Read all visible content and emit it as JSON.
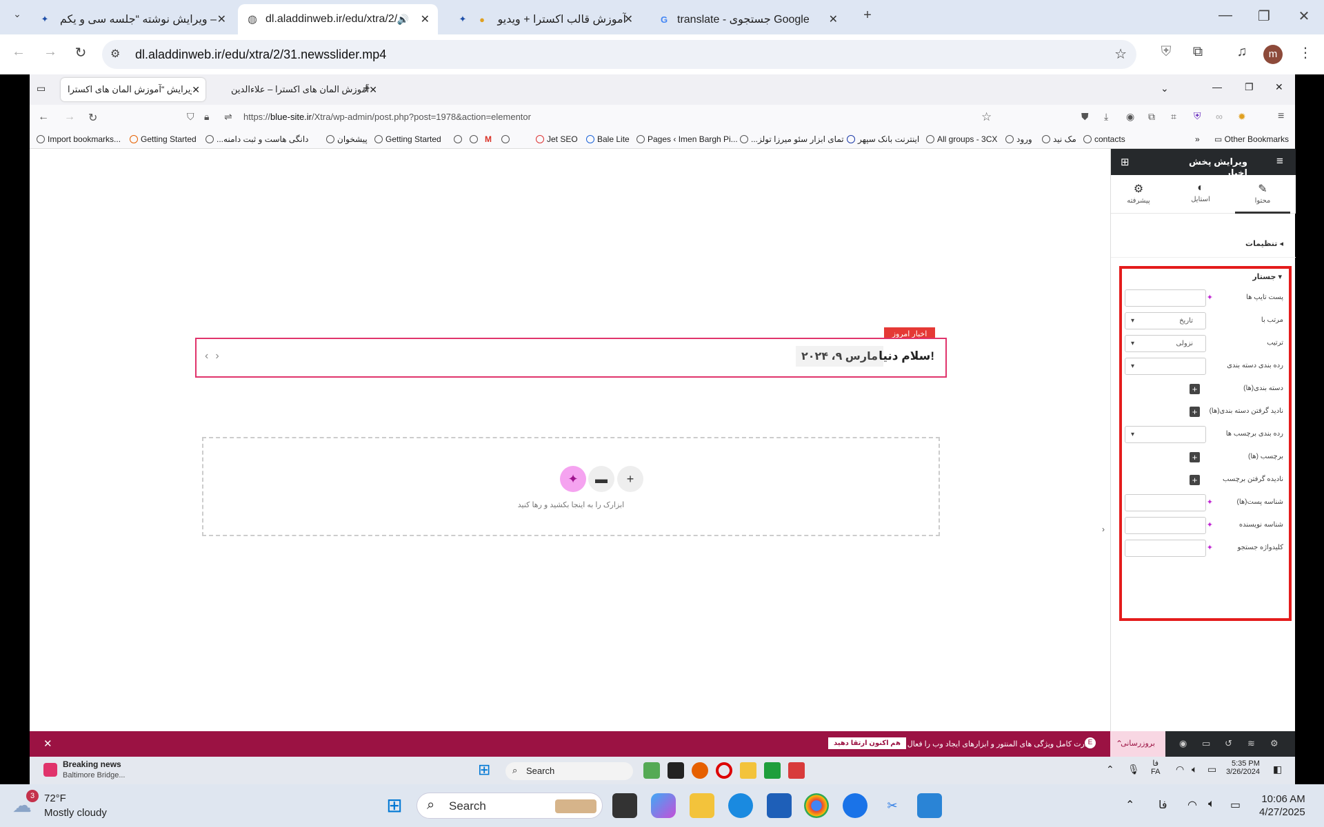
{
  "outer_tabs": [
    {
      "label": "ویرایش نوشته “جلسه سی و یکم –",
      "active": false
    },
    {
      "label": "dl.aladdinweb.ir/edu/xtra/2/",
      "active": true
    },
    {
      "label": "آموزش قالب اکسترا + ویدیو",
      "active": false
    },
    {
      "label": "translate - جستجوی Google",
      "active": false
    }
  ],
  "outer_url": "dl.aladdinweb.ir/edu/xtra/2/31.newsslider.mp4",
  "inner_tabs": [
    {
      "label": "ویرایش “آموزش المان های اکسترا – ",
      "active": true
    },
    {
      "label": "آموزش المان های اکسترا – علاءالدین",
      "active": false
    }
  ],
  "inner_url_prefix": "https://",
  "inner_url_host": "blue-site.ir",
  "inner_url_path": "/Xtra/wp-admin/post.php?post=1978&action=elementor",
  "bookmarks": [
    "Import bookmarks...",
    "Getting Started",
    "...دانگی هاست و ثبت دامنه",
    "پیشخوان",
    "Getting Started",
    "Jet SEO",
    "Bale Lite",
    "Pages ‹ Imen Bargh Pi...",
    "...تمای ابزار سئو میرزا تولز",
    "اینترنت بانک سپهر",
    "All groups - 3CX",
    "ورود",
    "مک نید",
    "contacts"
  ],
  "other_bookmarks": "Other Bookmarks",
  "news": {
    "badge": "اخبار امروز",
    "title": "سلام دنیا!",
    "date": "مارس ۹، ۲۰۲۴"
  },
  "dropzone_text": "ابزارک را به اینجا بکشید و رها کنید",
  "panel": {
    "title": "ویرایش پخش اخبار",
    "tabs": [
      {
        "label": "محتوا",
        "icon": "pencil-icon"
      },
      {
        "label": "استایل",
        "icon": "contrast-icon"
      },
      {
        "label": "پیشرفته",
        "icon": "gear-icon"
      }
    ],
    "settings_label": "تنظیمات",
    "query_label": "جستار",
    "query_rows": [
      {
        "label": "پست تایپ ها",
        "type": "input",
        "value": "",
        "dynamic": true
      },
      {
        "label": "مرتب با",
        "type": "select",
        "value": "تاریخ",
        "dynamic": false
      },
      {
        "label": "ترتیب",
        "type": "select",
        "value": "نزولی",
        "dynamic": false
      },
      {
        "label": "رده بندی دسته بندی",
        "type": "select",
        "value": "",
        "dynamic": false
      },
      {
        "label": "دسته بندی(ها)",
        "type": "plus",
        "value": "",
        "dynamic": false
      },
      {
        "label": "نادید گرفتن دسته بندی(ها)",
        "type": "plus",
        "value": "",
        "dynamic": false
      },
      {
        "label": "رده بندی برچسب ها",
        "type": "select",
        "value": "",
        "dynamic": false
      },
      {
        "label": "برچسب (ها)",
        "type": "plus",
        "value": "",
        "dynamic": false
      },
      {
        "label": "نادیده گرفتن برچسب",
        "type": "plus",
        "value": "",
        "dynamic": false
      },
      {
        "label": "شناسه پست(ها)",
        "type": "input",
        "value": "",
        "dynamic": true
      },
      {
        "label": "شناسه نویسنده",
        "type": "input",
        "value": "",
        "dynamic": true
      },
      {
        "label": "کلیدواژه جستجو",
        "type": "input",
        "value": "",
        "dynamic": true
      }
    ]
  },
  "notice": {
    "text": "قدرت کامل ویژگی های المنتور و ابزارهای ایجاد وب را فعال کنید.",
    "button": "هم اکنون ارتقا دهید"
  },
  "footer": {
    "publish": "بروزرسانی"
  },
  "inner_taskbar": {
    "news_title": "Breaking news",
    "news_sub": "Baltimore Bridge...",
    "search": "Search",
    "lang": "فا",
    "lang2": "FA",
    "time": "5:35 PM",
    "date": "3/26/2024"
  },
  "taskbar": {
    "weather_temp": "72°F",
    "weather_desc": "Mostly cloudy",
    "weather_badge": "3",
    "search": "Search",
    "lang": "فا",
    "time": "10:06 AM",
    "date": "4/27/2025"
  },
  "colors": {
    "accent_red": "#e41c1c",
    "notice_bg": "#9b1243",
    "elementor_dark": "#26292c",
    "ai_pink": "#f5a3f0"
  }
}
